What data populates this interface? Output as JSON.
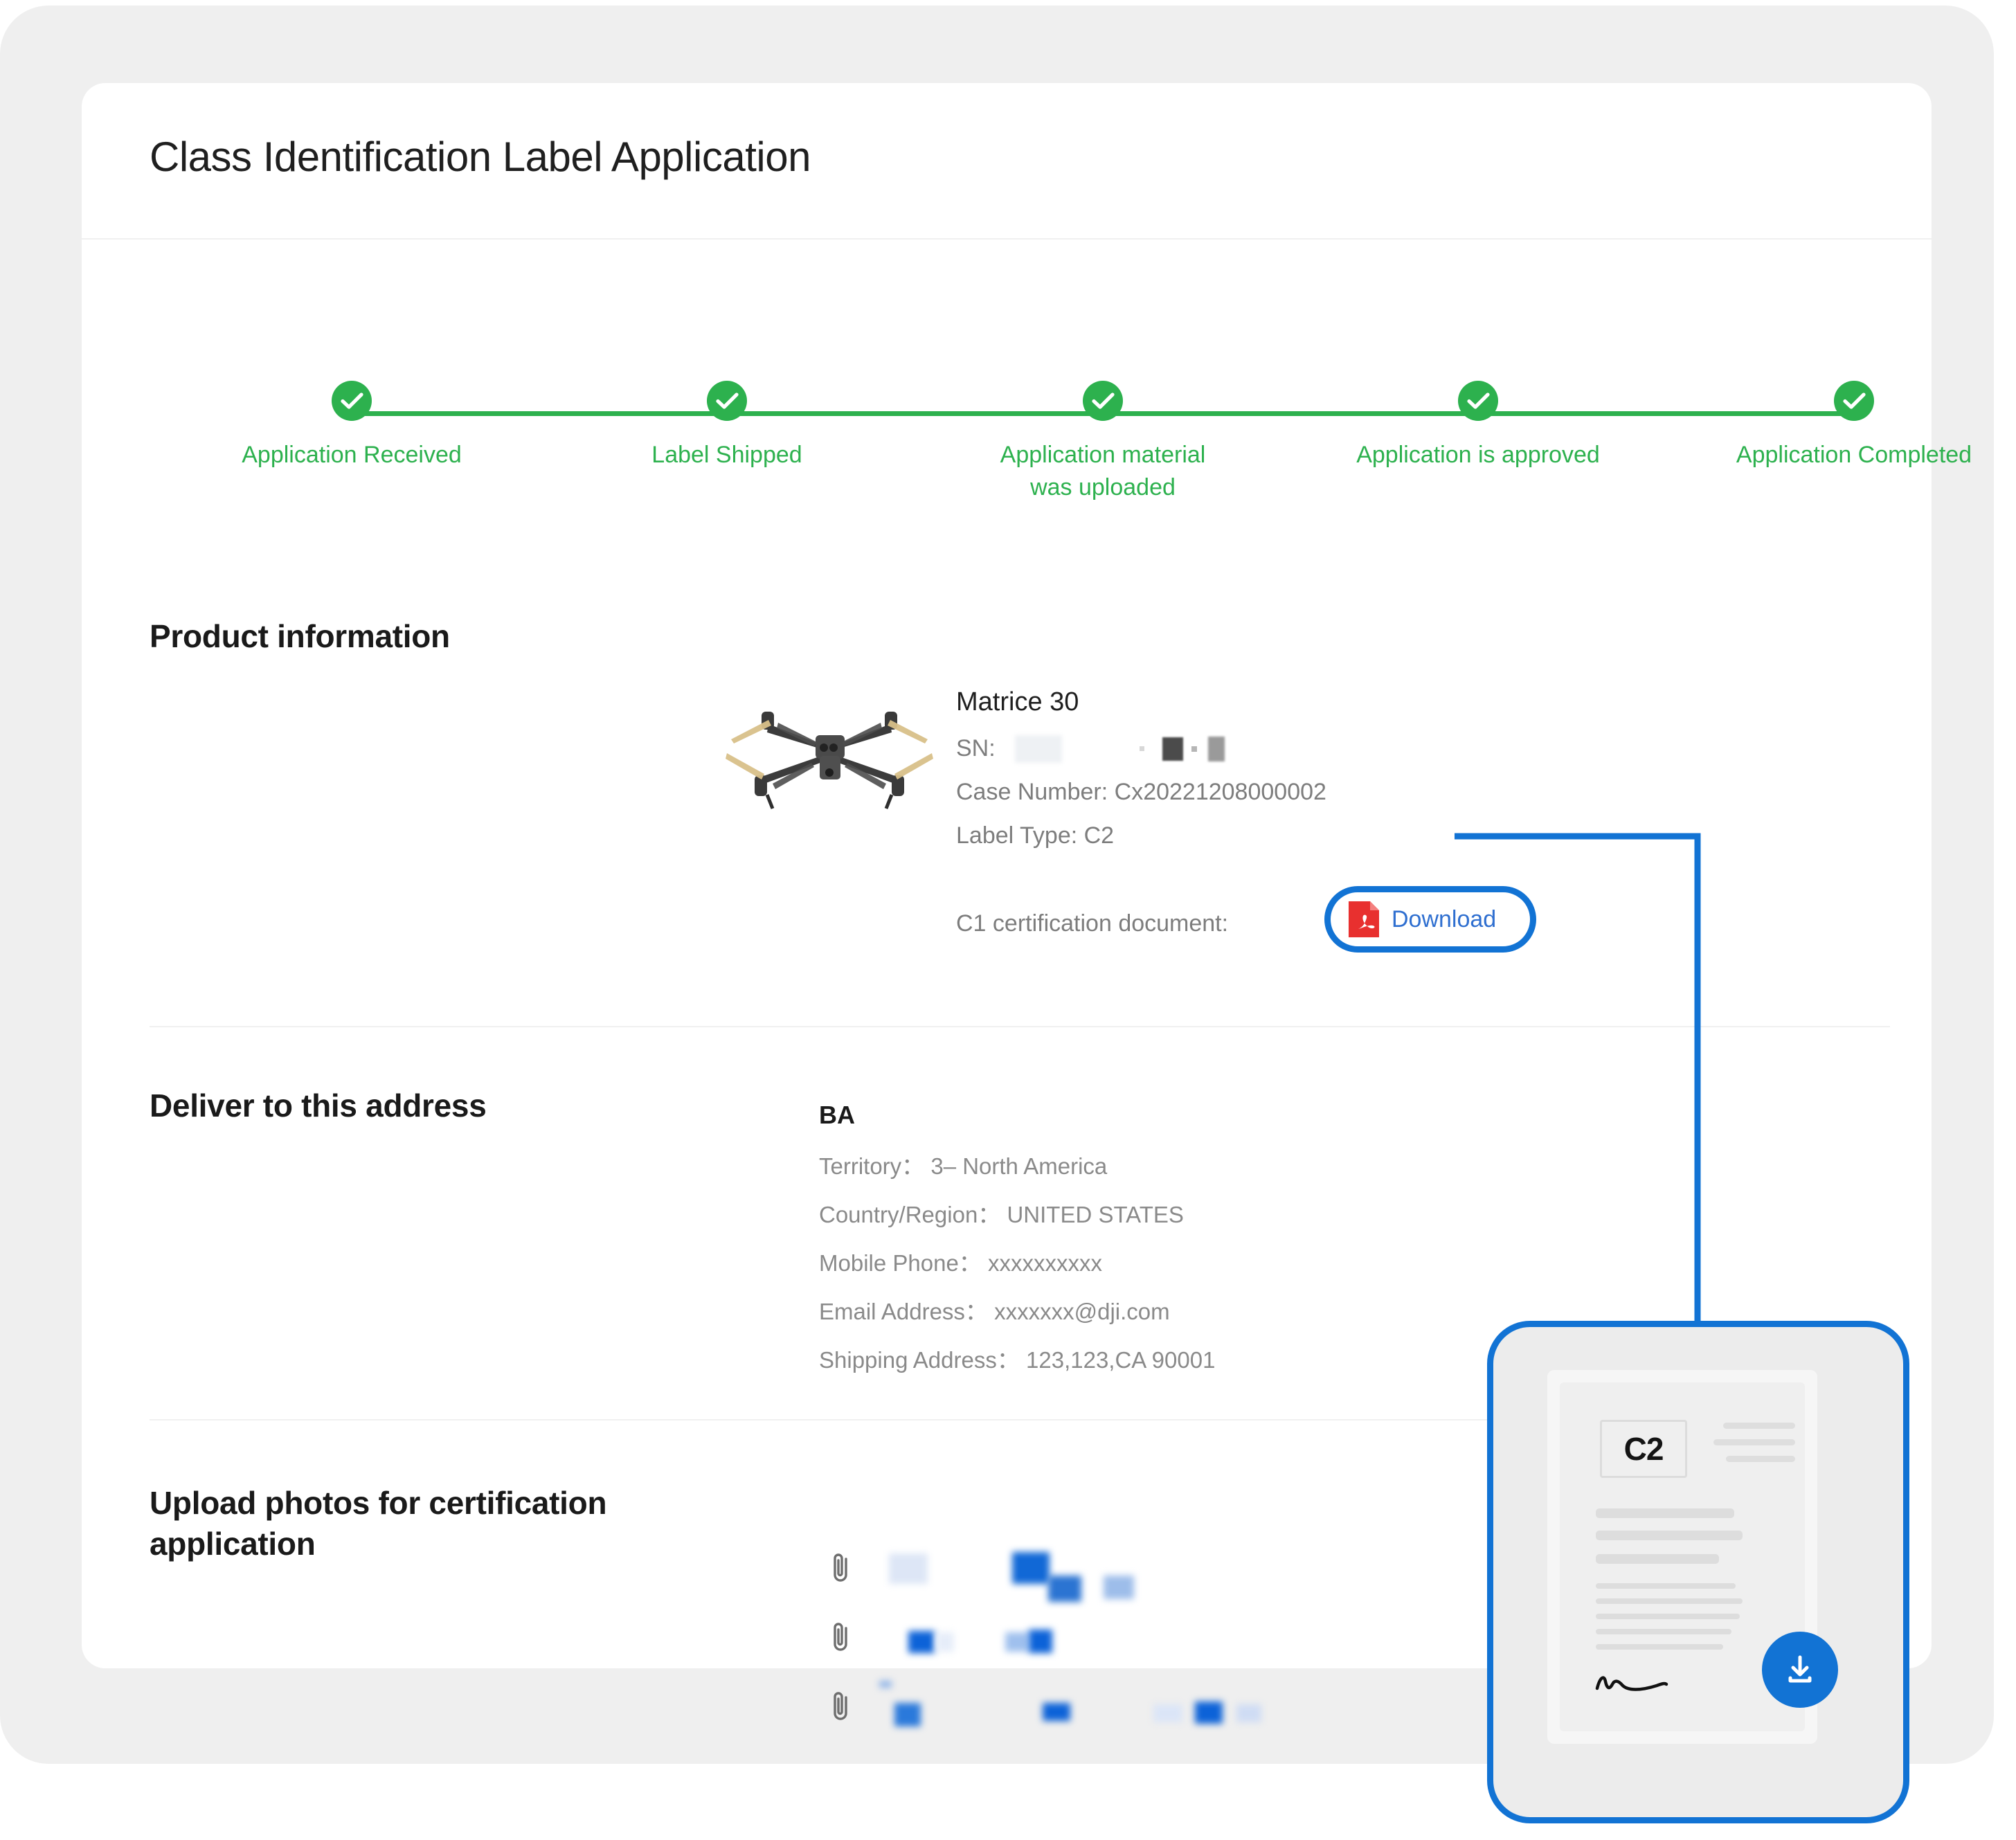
{
  "page": {
    "title": "Class Identification Label Application",
    "accent_blue": "#1273d4",
    "accent_green": "#2db14e",
    "pdf_red": "#e8302f"
  },
  "stepper": {
    "steps": [
      {
        "label": "Application Received",
        "state": "complete",
        "icon": "check-icon"
      },
      {
        "label": "Label Shipped",
        "state": "complete",
        "icon": "check-icon"
      },
      {
        "label": "Application material was uploaded",
        "state": "complete",
        "icon": "check-icon"
      },
      {
        "label": "Application is approved",
        "state": "complete",
        "icon": "check-icon"
      },
      {
        "label": "Application Completed",
        "state": "complete",
        "icon": "check-icon"
      }
    ]
  },
  "product_section": {
    "heading": "Product information",
    "product_name": "Matrice 30",
    "sn_label": "SN:",
    "sn_value": "",
    "case_number": "Case Number: Cx20221208000002",
    "label_type": "Label Type: C2",
    "cert_doc_label": "C1 certification document:",
    "download_label": "Download",
    "pdf_icon": "pdf-file-icon"
  },
  "address_section": {
    "heading": "Deliver to this address",
    "recipient": "BA",
    "lines": [
      "Territory： 3– North America",
      "Country/Region： UNITED STATES",
      "Mobile Phone： xxxxxxxxxx",
      "Email Address： xxxxxxx@dji.com",
      "Shipping Address： 123,123,CA 90001"
    ]
  },
  "uploads_section": {
    "heading": "Upload photos for certification application",
    "attachments": [
      {
        "icon": "paperclip-icon",
        "filename": ""
      },
      {
        "icon": "paperclip-icon",
        "filename": ""
      },
      {
        "icon": "paperclip-icon",
        "filename": ""
      }
    ]
  },
  "callout": {
    "document_badge": "C2",
    "download_icon": "download-arrow-icon",
    "signature": "signature-mark"
  }
}
